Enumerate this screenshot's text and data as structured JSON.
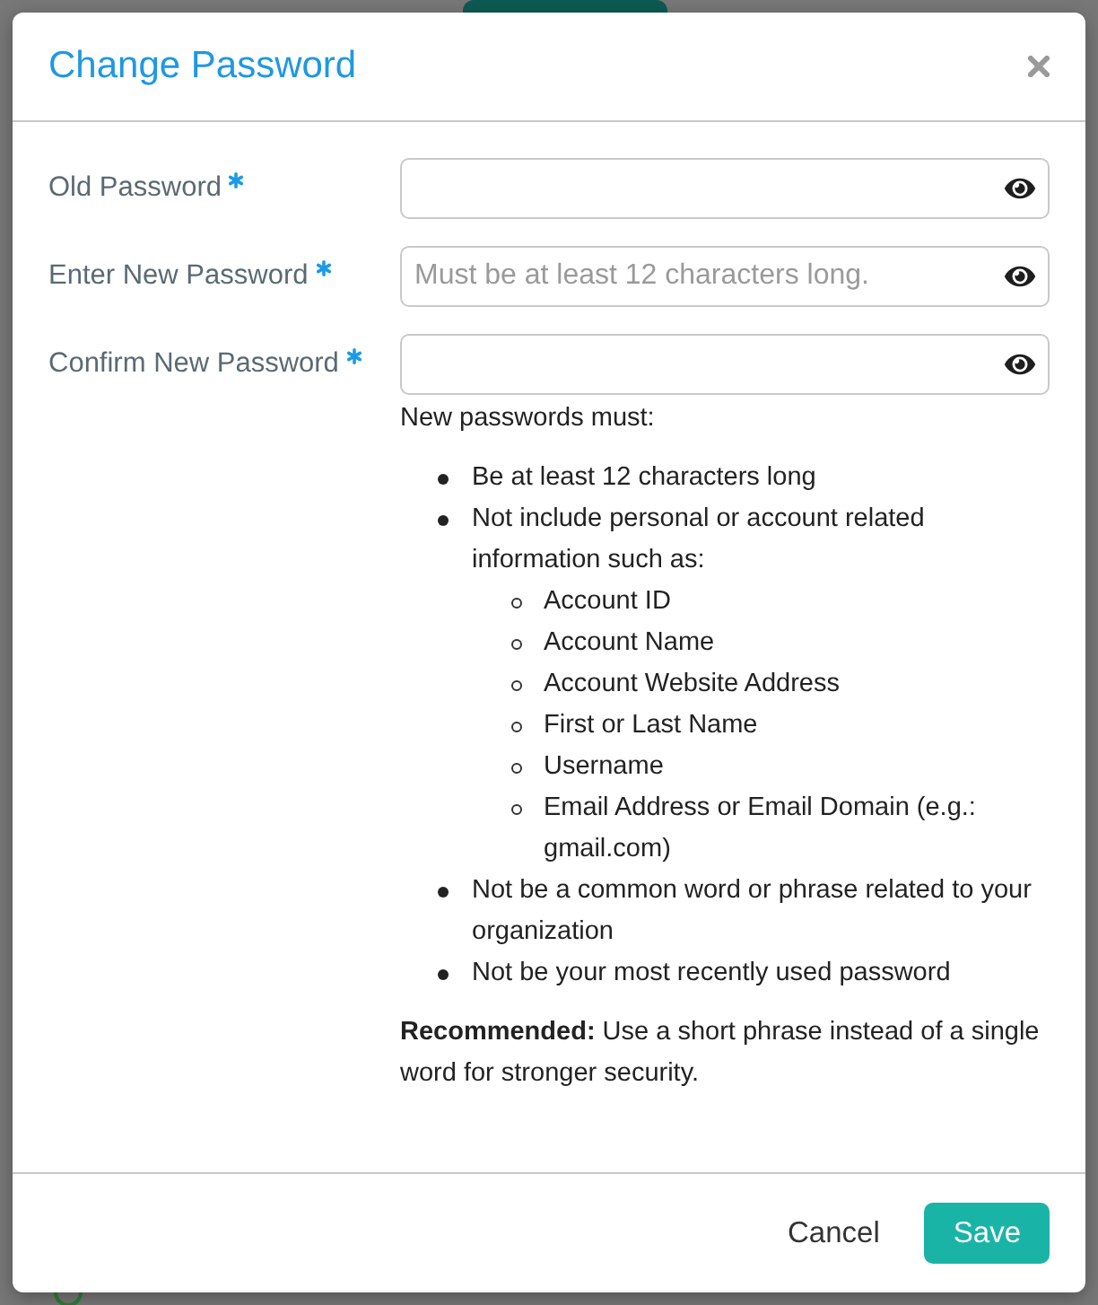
{
  "dialog": {
    "title": "Change Password"
  },
  "fields": [
    {
      "label": "Old Password",
      "required": true
    },
    {
      "label": "Enter New Password",
      "required": true,
      "placeholder": "Must be at least 12 characters long."
    },
    {
      "label": "Confirm New Password",
      "required": true
    }
  ],
  "requirements": {
    "intro": "New passwords must:",
    "items": [
      {
        "text": "Be at least 12 characters long"
      },
      {
        "text": "Not include personal or account related information such as:",
        "children": [
          {
            "text": "Account ID"
          },
          {
            "text": "Account Name"
          },
          {
            "text": "Account Website Address"
          },
          {
            "text": "First or Last Name"
          },
          {
            "text": "Username"
          },
          {
            "text": "Email Address or Email Domain (e.g.: gmail.com)"
          }
        ]
      },
      {
        "text": "Not be a common word or phrase related to your organization"
      },
      {
        "text": "Not be your most recently used password"
      }
    ]
  },
  "note": "**Recommended:** Use a short phrase instead of a single word for stronger security.",
  "buttons": [
    {
      "label": "Cancel",
      "kind": "secondary"
    },
    {
      "label": "Save",
      "kind": "primary"
    }
  ]
}
